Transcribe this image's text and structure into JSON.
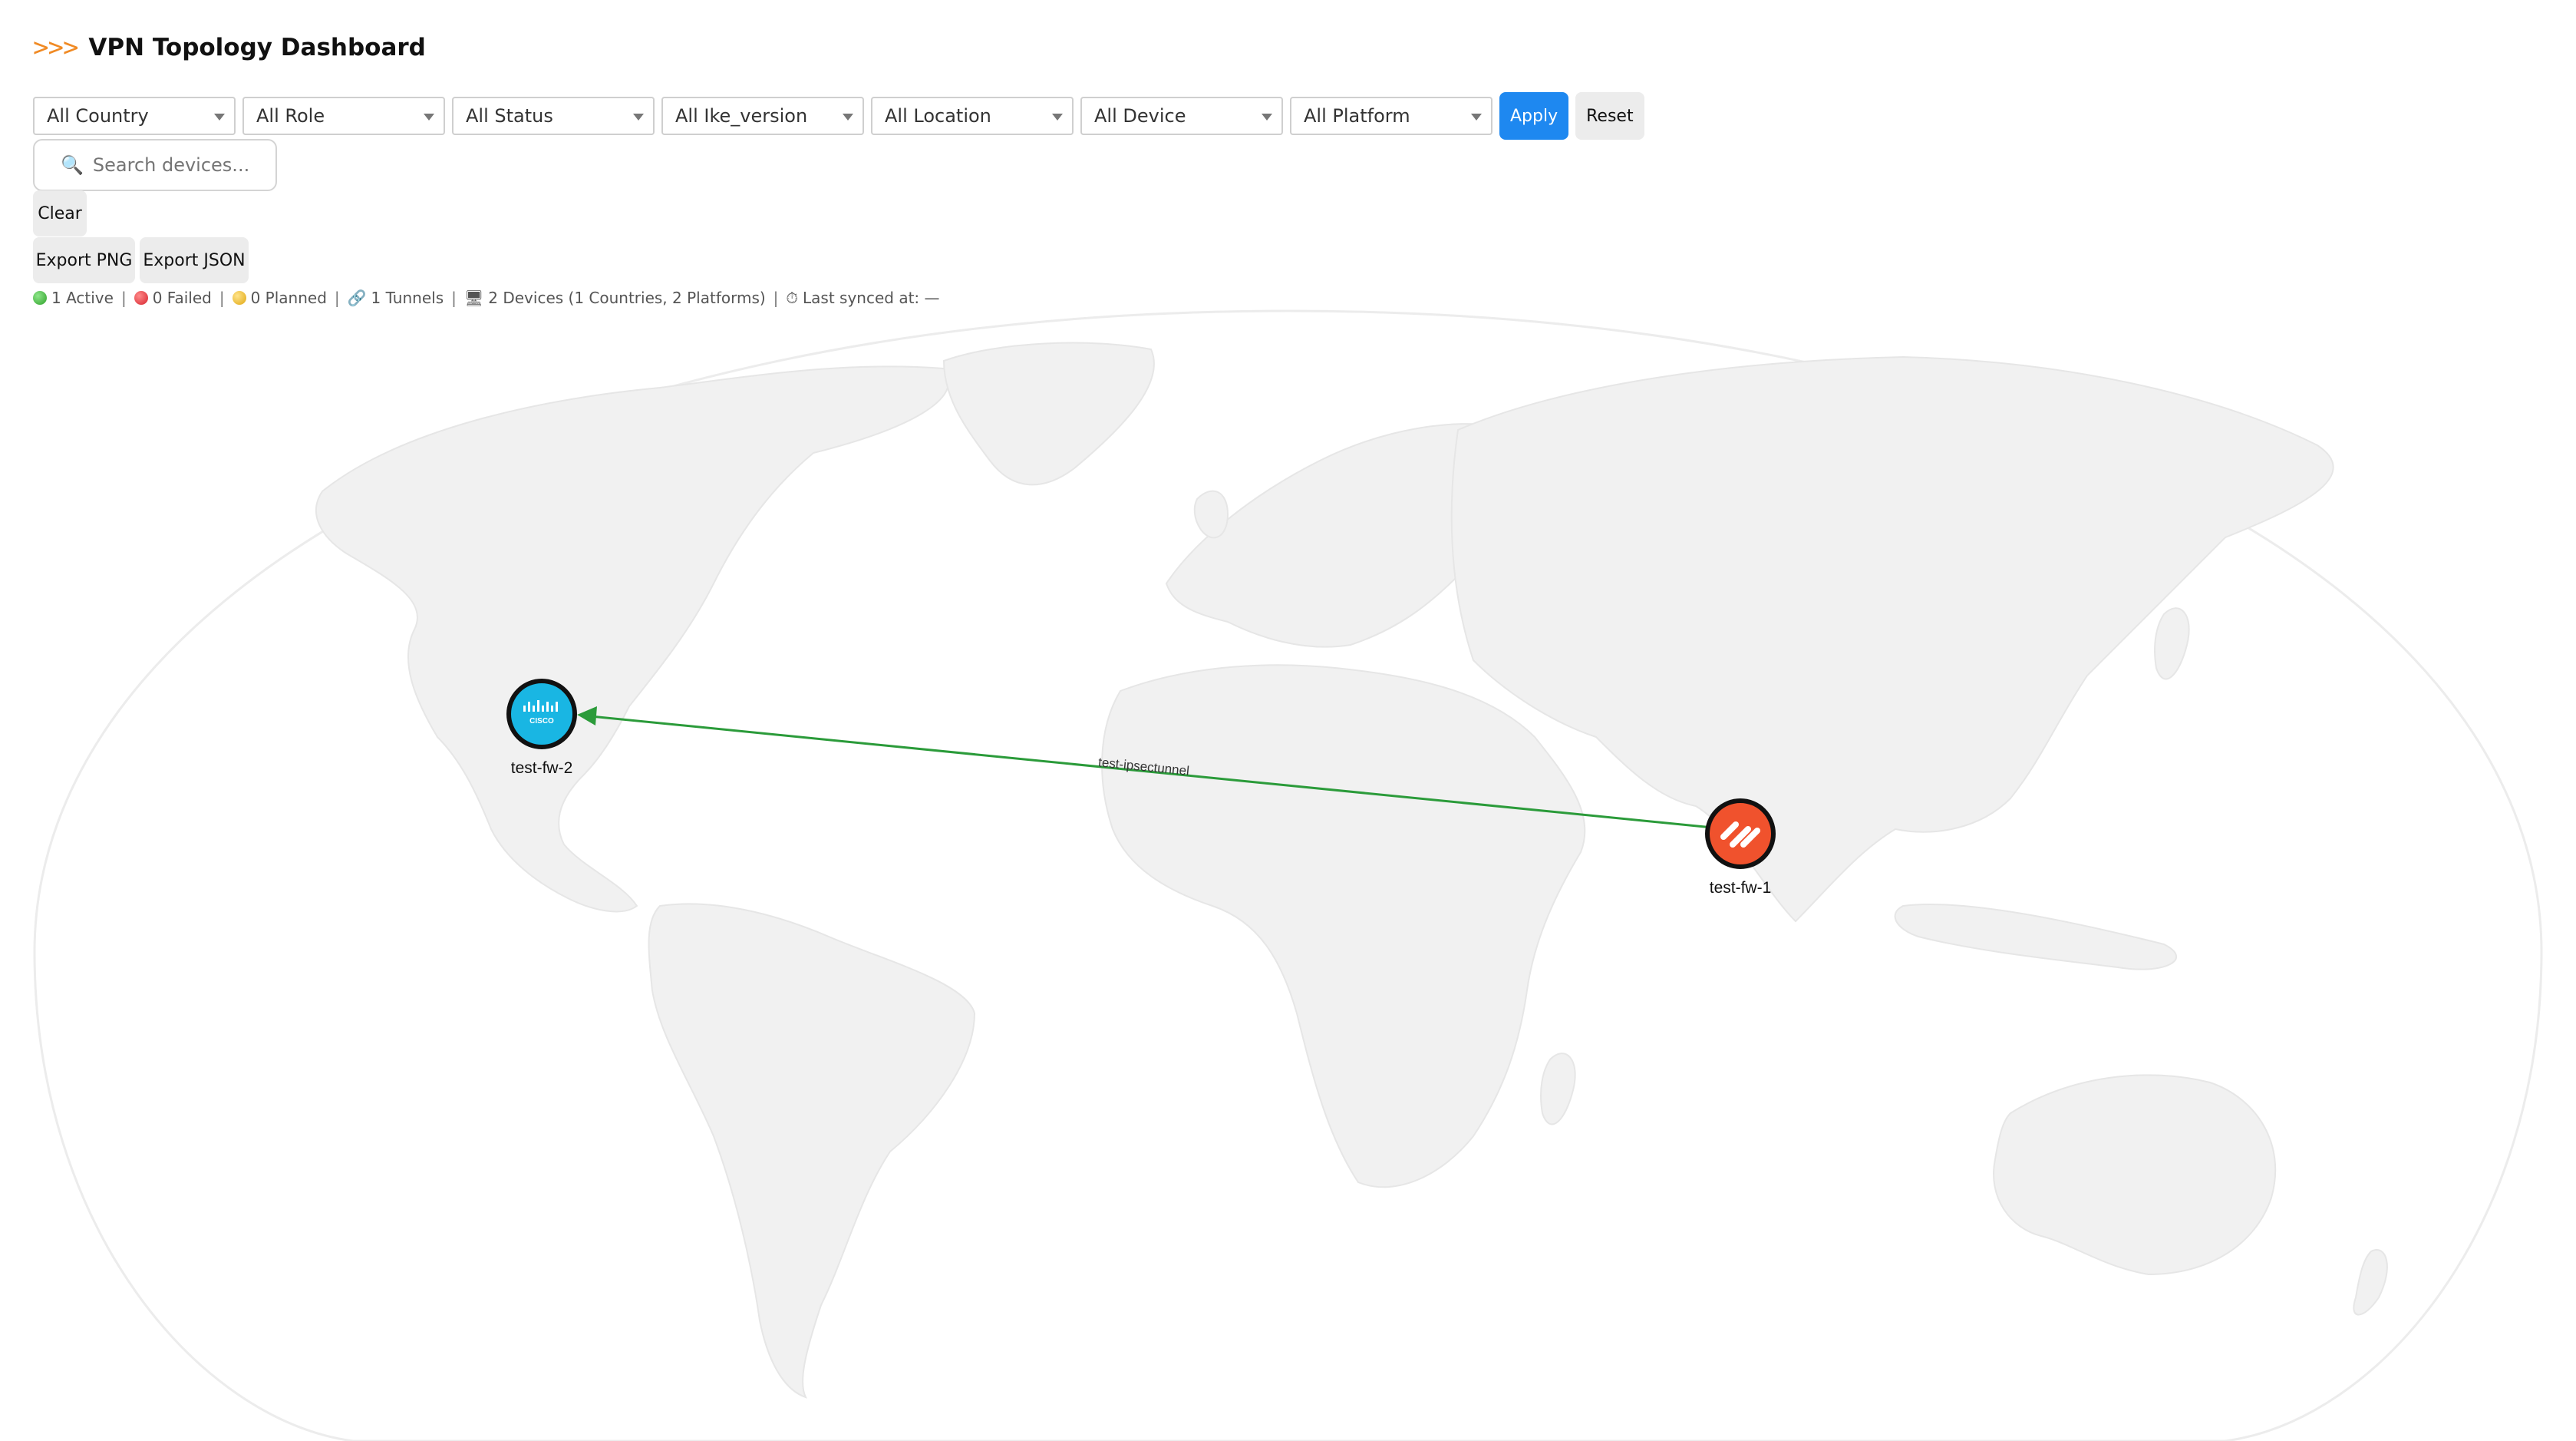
{
  "header": {
    "chevrons": ">>>",
    "title": "VPN Topology Dashboard"
  },
  "filters": {
    "selects": [
      {
        "label": "All Country"
      },
      {
        "label": "All Role"
      },
      {
        "label": "All Status"
      },
      {
        "label": "All Ike_version"
      },
      {
        "label": "All Location"
      },
      {
        "label": "All Device"
      },
      {
        "label": "All Platform"
      }
    ],
    "apply_label": "Apply",
    "reset_label": "Reset"
  },
  "search": {
    "placeholder": "Search devices...",
    "icon": "magnifier-icon",
    "clear_label": "Clear"
  },
  "export": {
    "png_label": "Export PNG",
    "json_label": "Export JSON"
  },
  "status": {
    "active": "1 Active",
    "failed": "0 Failed",
    "planned": "0 Planned",
    "tunnels": "1 Tunnels",
    "devices": "2 Devices (1 Countries, 2 Platforms)",
    "last_synced": "Last synced at: —",
    "colors": {
      "active": "#2fa12a",
      "failed": "#d6242e",
      "planned": "#e0a712"
    }
  },
  "topology": {
    "nodes": [
      {
        "id": "test-fw-2",
        "label": "test-fw-2",
        "platform": "cisco",
        "logo_text": "CISCO",
        "color": "#19b6e3"
      },
      {
        "id": "test-fw-1",
        "label": "test-fw-1",
        "platform": "paloalto",
        "color": "#f0522d"
      }
    ],
    "edges": [
      {
        "from": "test-fw-1",
        "to": "test-fw-2",
        "label": "test-ipsectunnel",
        "status": "active",
        "color": "#2b9b3a"
      }
    ]
  }
}
